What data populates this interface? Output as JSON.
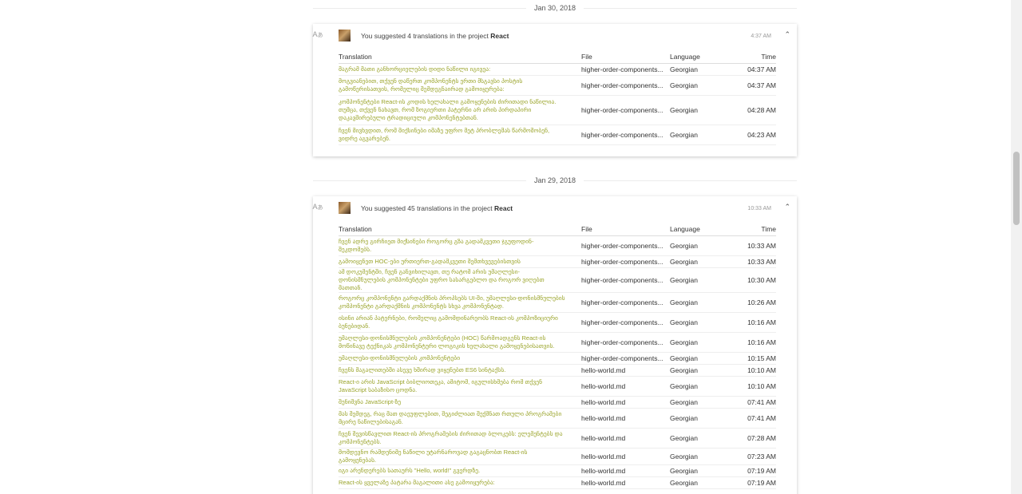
{
  "groups": [
    {
      "date": "Jan 30, 2018",
      "icon": "translate-icon",
      "summary_prefix": "You suggested 4 translations in the project",
      "project": "React",
      "time": "4:37 AM",
      "columns": {
        "translation": "Translation",
        "file": "File",
        "language": "Language",
        "time": "Time"
      },
      "rows": [
        {
          "text": "მაგრამ მათი განხორციელების დიდი ნაწილი იგივეა:",
          "file": "higher-order-components...",
          "language": "Georgian",
          "time": "04:37 AM",
          "h": 1
        },
        {
          "text": "მოგვიანებით, თქვენ დაწერთ კომპონენტს ერთი მსგავსი პოსტის გამოწერისათვის, რომელიც შემდეგნაირად გამოიყურება:",
          "file": "higher-order-components...",
          "language": "Georgian",
          "time": "04:37 AM",
          "h": 2
        },
        {
          "text": "კომპონენტები React-ის კოდის ხელახალი გამოყენების ძირითადი ნაწილია. თუმცა, თქვენ ნახავთ, რომ ზოგიერთი პატერნი არ არის პირდაპირი დაკავშირებული ტრადიციული კომპონენტებთან.",
          "file": "higher-order-components...",
          "language": "Georgian",
          "time": "04:28 AM",
          "h": 3
        },
        {
          "text": "ჩვენ მივხვდით, რომ მიქსინები იმაზე უფრო მეტ პრობლემას წარმოშობენ, ვიდრე აგვარებენ.",
          "file": "higher-order-components...",
          "language": "Georgian",
          "time": "04:23 AM",
          "h": 2
        }
      ]
    },
    {
      "date": "Jan 29, 2018",
      "icon": "translate-icon",
      "summary_prefix": "You suggested 45 translations in the project",
      "project": "React",
      "time": "10:33 AM",
      "columns": {
        "translation": "Translation",
        "file": "File",
        "language": "Language",
        "time": "Time"
      },
      "rows": [
        {
          "text": "ჩვენ ადრე გირჩიეთ მიქსინები როგორც გზა გადამკვეთი ჯგუფოდინ-შეკდომებს.",
          "file": "higher-order-components...",
          "language": "Georgian",
          "time": "10:33 AM",
          "h": 2
        },
        {
          "text": "გამოიყენეთ HOC-ები ურთიერთ-გადამკვეთი შემთხვევებისთვის",
          "file": "higher-order-components...",
          "language": "Georgian",
          "time": "10:33 AM",
          "h": 1
        },
        {
          "text": "ამ დოკუმენტში, ჩვენ განვიხილავთ, თუ რატომ არის უმაღლესი-დონისმნულების კომპონენტები უფრო სასარგებლო და როგორ ვიღებთ მათთან.",
          "file": "higher-order-components...",
          "language": "Georgian",
          "time": "10:30 AM",
          "h": 2
        },
        {
          "text": "როგორც კომპონენტი გარდაქმნის პროპსებს UI-ში, უმაღლესი-დონისმნულების კომპონენტი გარდაქმნის კომპონენტს სხვა კომპონენტად.",
          "file": "higher-order-components...",
          "language": "Georgian",
          "time": "10:26 AM",
          "h": 2
        },
        {
          "text": "ისინი არიან პატერნები, რომელიც გამომდინარეობს React-ის კომპოზიციური ბუნებიდან.",
          "file": "higher-order-components...",
          "language": "Georgian",
          "time": "10:16 AM",
          "h": 2
        },
        {
          "text": "უმაღლესი-დონისმნულების კომპონენტები (HOC) წარმოადგენს React-ის მოწინავე ტექნიკას კომპონენტური ლოგიკის ხელახალი გამოყენებისათვის.",
          "file": "higher-order-components...",
          "language": "Georgian",
          "time": "10:16 AM",
          "h": 2
        },
        {
          "text": "უმაღლესი-დონისმნულების კომპონენტები",
          "file": "higher-order-components...",
          "language": "Georgian",
          "time": "10:15 AM",
          "h": 1
        },
        {
          "text": "ჩვენს მაგალითებში ასევე ხშირად ვიყენებთ ES6 სინტაქსს.",
          "file": "hello-world.md",
          "language": "Georgian",
          "time": "10:10 AM",
          "h": 1
        },
        {
          "text": "React-ი არის JavaScript ბიბლიოთეკა, ამიტომ, იგულისხმება რომ თქვენ JavaScript საბაზისო ცოდნა.",
          "file": "hello-world.md",
          "language": "Georgian",
          "time": "10:10 AM",
          "h": 2
        },
        {
          "text": "შენიშვნა JavaScript-ზე",
          "file": "hello-world.md",
          "language": "Georgian",
          "time": "07:41 AM",
          "h": 1
        },
        {
          "text": "მას შემდეგ, რაც მათ დაეუფლებით, შეგიძლიათ შექმნათ რთული პროგრამები მცირე ნაწილებისაგან.",
          "file": "hello-world.md",
          "language": "Georgian",
          "time": "07:41 AM",
          "h": 2
        },
        {
          "text": "ჩვენ შევისწავლით React-ის პროგრამების ძირითად ბლოკებს: ელემენტებს და კომპონენტებს.",
          "file": "hello-world.md",
          "language": "Georgian",
          "time": "07:28 AM",
          "h": 2
        },
        {
          "text": "მომდევნო რამდენიმე ნაწილი უტარნაროვად გაგაცნობთ React-ის გამოყენებას.",
          "file": "hello-world.md",
          "language": "Georgian",
          "time": "07:23 AM",
          "h": 1
        },
        {
          "text": "იგი არენდერებს სათაურს \"Hello, world!\" გვერდზე.",
          "file": "hello-world.md",
          "language": "Georgian",
          "time": "07:19 AM",
          "h": 1
        },
        {
          "text": "React-ის ყველაზე პატარა მაგალითი ასე გამოიყურება:",
          "file": "hello-world.md",
          "language": "Georgian",
          "time": "07:19 AM",
          "h": 1
        }
      ]
    }
  ]
}
